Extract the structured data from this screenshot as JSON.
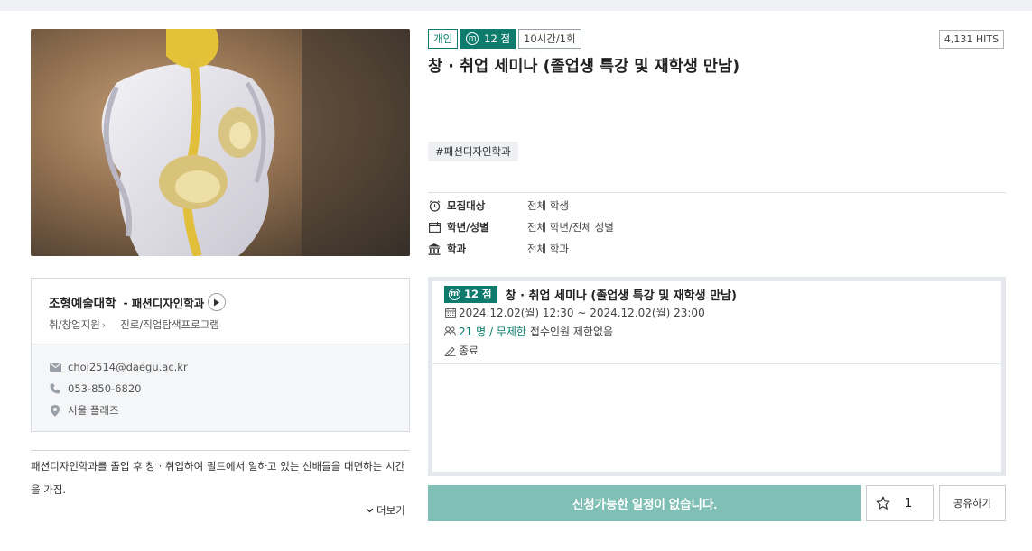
{
  "program": {
    "badge_type": "개인",
    "badge_points": "12 점",
    "badge_duration": "10시간/1회",
    "hits": "4,131 HITS",
    "title": "창 · 취업 세미나 (졸업생 특강 및 재학생 만남)",
    "tag": "#패션디자인학과",
    "info": [
      {
        "icon": "alarm-clock-icon",
        "label": "모집대상",
        "value": "전체 학생"
      },
      {
        "icon": "calendar-icon",
        "label": "학년/성별",
        "value": "전체 학년/전체 성별"
      },
      {
        "icon": "building-icon",
        "label": "학과",
        "value": "전체 학과"
      }
    ]
  },
  "department": {
    "university": "조형예술대학",
    "separator": "-",
    "name": "패션디자인학과",
    "category": "취/창업지원",
    "subcategory": "진로/직업탐색프로그램",
    "email": "choi2514@daegu.ac.kr",
    "phone": "053-850-6820",
    "location": "서울 플래즈"
  },
  "description": {
    "text": "패션디자인학과를 졸업 후 창 · 취업하여 필드에서 일하고 있는 선배들을 대면하는 시간을 가짐.",
    "more_label": "더보기"
  },
  "schedule": {
    "badge": "12 점",
    "title": "창 · 취업 세미나 (졸업생 특강 및 재학생 만남)",
    "datetime": "2024.12.02(월) 12:30 ~ 2024.12.02(월) 23:00",
    "capacity": "21 명 / 무제한",
    "capacity_note": "접수인원 제한없음",
    "status": "종료"
  },
  "actions": {
    "apply_label": "신청가능한 일정이 없습니다.",
    "favorite_count": "1",
    "share_label": "공유하기"
  },
  "colors": {
    "accent": "#0e7b6d",
    "apply_disabled": "#80bfb6"
  }
}
